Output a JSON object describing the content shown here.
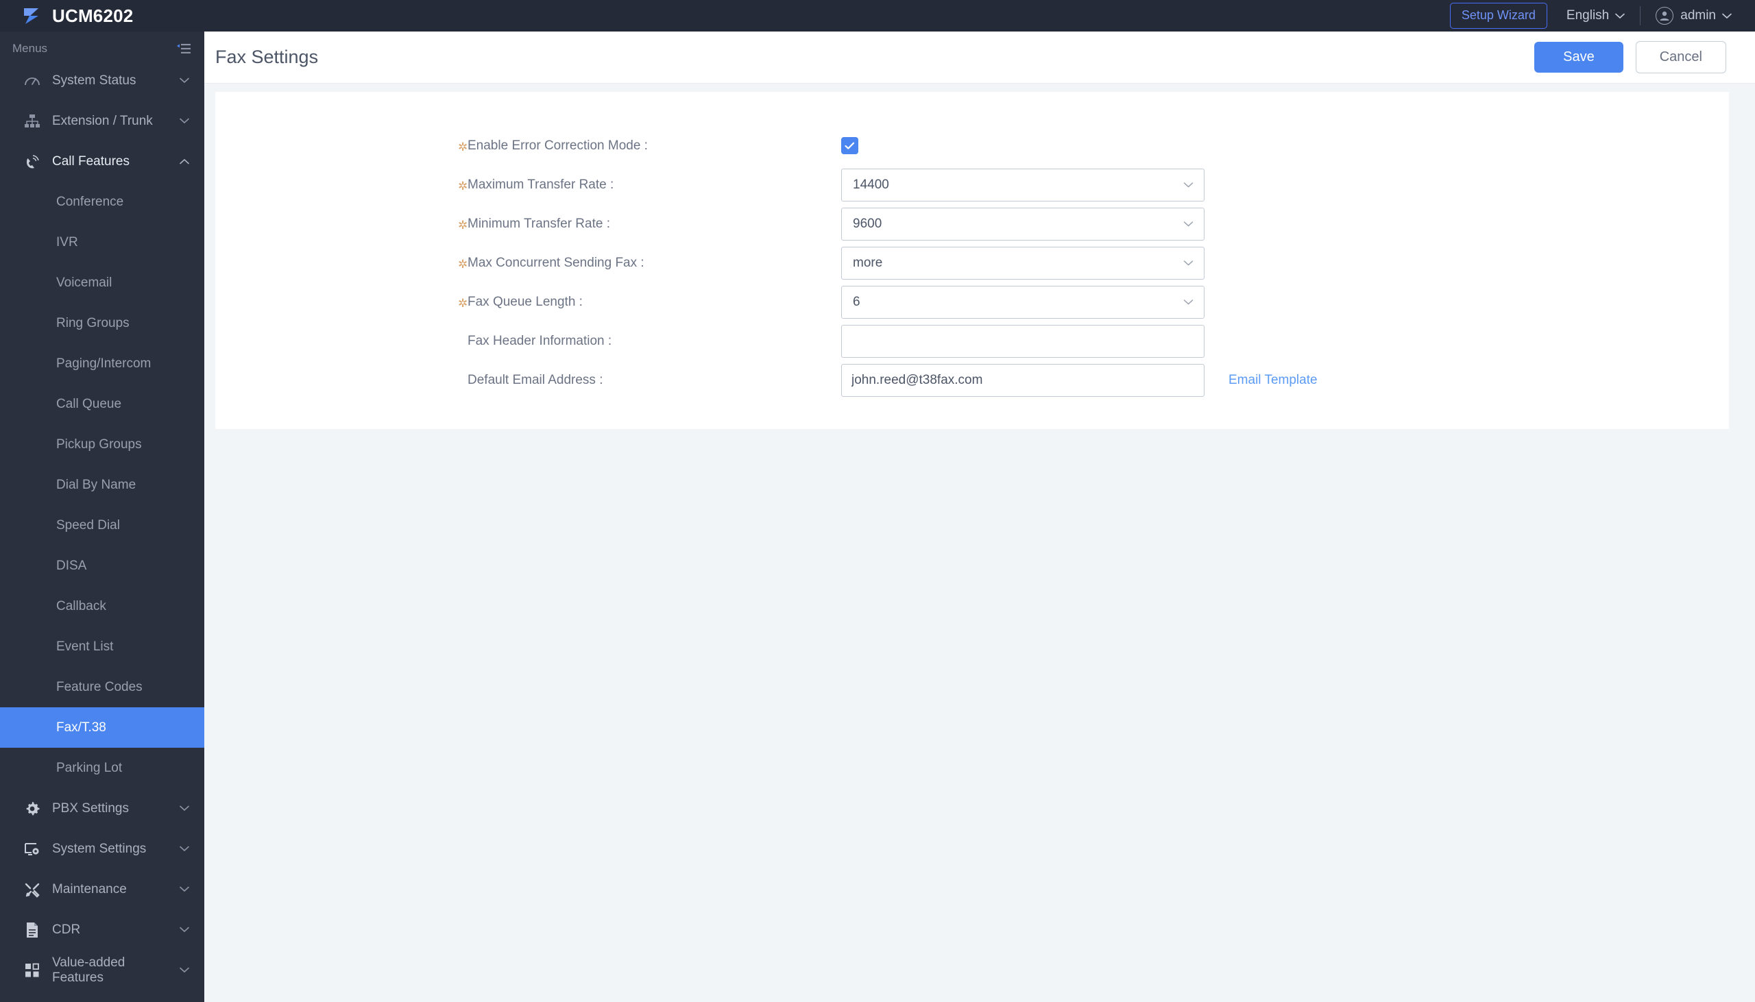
{
  "topbar": {
    "brand": "UCM6202",
    "logo_icon": "grandstream-logo-icon",
    "setup_wizard_label": "Setup Wizard",
    "language_label": "English",
    "user_label": "admin",
    "accent": "#4a85f0"
  },
  "sidebar": {
    "menus_label": "Menus",
    "collapse_icon": "menu-collapse-icon",
    "groups": [
      {
        "label": "System Status",
        "icon": "gauge-icon",
        "expanded": false
      },
      {
        "label": "Extension / Trunk",
        "icon": "sitemap-icon",
        "expanded": false
      },
      {
        "label": "Call Features",
        "icon": "phone-wave-icon",
        "expanded": true
      }
    ],
    "call_features_items": [
      "Conference",
      "IVR",
      "Voicemail",
      "Ring Groups",
      "Paging/Intercom",
      "Call Queue",
      "Pickup Groups",
      "Dial By Name",
      "Speed Dial",
      "DISA",
      "Callback",
      "Event List",
      "Feature Codes",
      "Fax/T.38",
      "Parking Lot"
    ],
    "selected_item": "Fax/T.38",
    "bottom_groups": [
      {
        "label": "PBX Settings",
        "icon": "gear-icon"
      },
      {
        "label": "System Settings",
        "icon": "monitor-gear-icon"
      },
      {
        "label": "Maintenance",
        "icon": "tools-icon"
      },
      {
        "label": "CDR",
        "icon": "document-icon"
      },
      {
        "label": "Value-added Features",
        "icon": "grid-blocks-icon"
      }
    ]
  },
  "content": {
    "page_title": "Fax Settings",
    "save_label": "Save",
    "cancel_label": "Cancel",
    "email_template_link": "Email Template",
    "fields": [
      {
        "label": "Enable Error Correction Mode :",
        "required": true,
        "type": "checkbox",
        "checked": true
      },
      {
        "label": "Maximum Transfer Rate :",
        "required": true,
        "type": "select",
        "value": "14400"
      },
      {
        "label": "Minimum Transfer Rate :",
        "required": true,
        "type": "select",
        "value": "9600"
      },
      {
        "label": "Max Concurrent Sending Fax :",
        "required": true,
        "type": "select",
        "value": "more"
      },
      {
        "label": "Fax Queue Length :",
        "required": true,
        "type": "select",
        "value": "6"
      },
      {
        "label": "Fax Header Information :",
        "required": false,
        "type": "text",
        "value": "",
        "placeholder": ""
      },
      {
        "label": "Default Email Address :",
        "required": false,
        "type": "text",
        "value": "john.reed@t38fax.com",
        "placeholder": ""
      }
    ]
  }
}
